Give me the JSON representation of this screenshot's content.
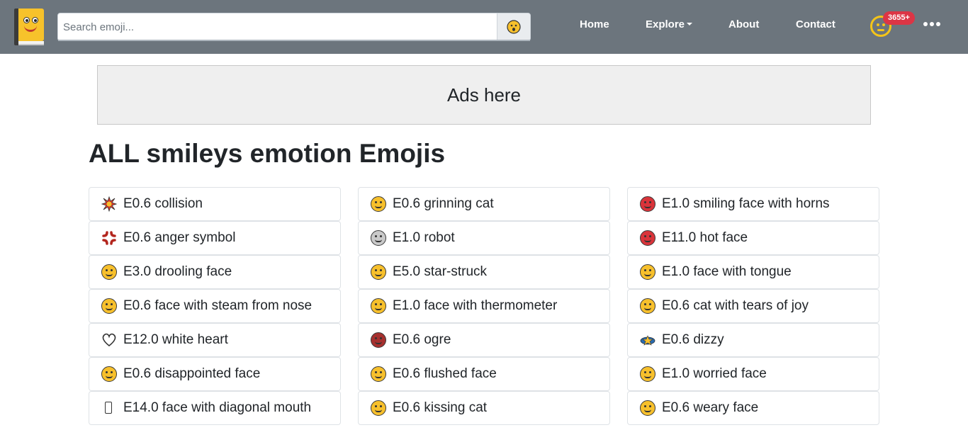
{
  "search": {
    "placeholder": "Search emoji..."
  },
  "nav": {
    "home": "Home",
    "explore": "Explore",
    "about": "About",
    "contact": "Contact",
    "badge": "3655+"
  },
  "ads": {
    "label": "Ads here"
  },
  "page_title": "ALL smileys emotion Emojis",
  "columns": [
    [
      {
        "label": "E0.6 collision",
        "icon": "collision-icon"
      },
      {
        "label": "E0.6 anger symbol",
        "icon": "anger-symbol-icon"
      },
      {
        "label": "E3.0 drooling face",
        "icon": "drooling-face-icon"
      },
      {
        "label": "E0.6 face with steam from nose",
        "icon": "face-steam-icon"
      },
      {
        "label": "E12.0 white heart",
        "icon": "white-heart-icon"
      },
      {
        "label": "E0.6 disappointed face",
        "icon": "disappointed-face-icon"
      },
      {
        "label": "E14.0 face with diagonal mouth",
        "icon": "missing-glyph-icon"
      }
    ],
    [
      {
        "label": "E0.6 grinning cat",
        "icon": "grinning-cat-icon"
      },
      {
        "label": "E1.0 robot",
        "icon": "robot-icon"
      },
      {
        "label": "E5.0 star-struck",
        "icon": "star-struck-icon"
      },
      {
        "label": "E1.0 face with thermometer",
        "icon": "thermometer-face-icon"
      },
      {
        "label": "E0.6 ogre",
        "icon": "ogre-icon"
      },
      {
        "label": "E0.6 flushed face",
        "icon": "flushed-face-icon"
      },
      {
        "label": "E0.6 kissing cat",
        "icon": "kissing-cat-icon"
      }
    ],
    [
      {
        "label": "E1.0 smiling face with horns",
        "icon": "horns-face-icon"
      },
      {
        "label": "E11.0 hot face",
        "icon": "hot-face-icon"
      },
      {
        "label": "E1.0 face with tongue",
        "icon": "tongue-face-icon"
      },
      {
        "label": "E0.6 cat with tears of joy",
        "icon": "cat-tears-joy-icon"
      },
      {
        "label": "E0.6 dizzy",
        "icon": "dizzy-icon"
      },
      {
        "label": "E1.0 worried face",
        "icon": "worried-face-icon"
      },
      {
        "label": "E0.6 weary face",
        "icon": "weary-face-icon"
      }
    ]
  ]
}
